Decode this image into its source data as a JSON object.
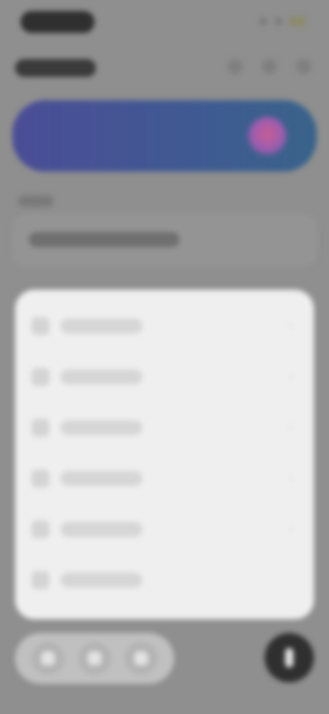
{
  "status_bar": {
    "time": ""
  },
  "header": {
    "title": ""
  },
  "banner": {
    "text": ""
  },
  "section": {
    "label": "",
    "info_text": ""
  },
  "menu": {
    "items": [
      {
        "label": ""
      },
      {
        "label": ""
      },
      {
        "label": ""
      },
      {
        "label": ""
      },
      {
        "label": ""
      },
      {
        "label": ""
      }
    ]
  },
  "bottom_nav": {
    "items": [
      {
        "label": ""
      },
      {
        "label": ""
      },
      {
        "label": ""
      }
    ]
  },
  "fab": {
    "label": ""
  },
  "colors": {
    "background": "#8f8f8f",
    "banner_start": "#4b4d96",
    "banner_end": "#39638a",
    "menu_card": "#efefef",
    "fab": "#2f2f2f"
  },
  "icons": {
    "banner": "heart-icon",
    "fab": "plus-icon",
    "chevron": "chevron-right-icon"
  }
}
